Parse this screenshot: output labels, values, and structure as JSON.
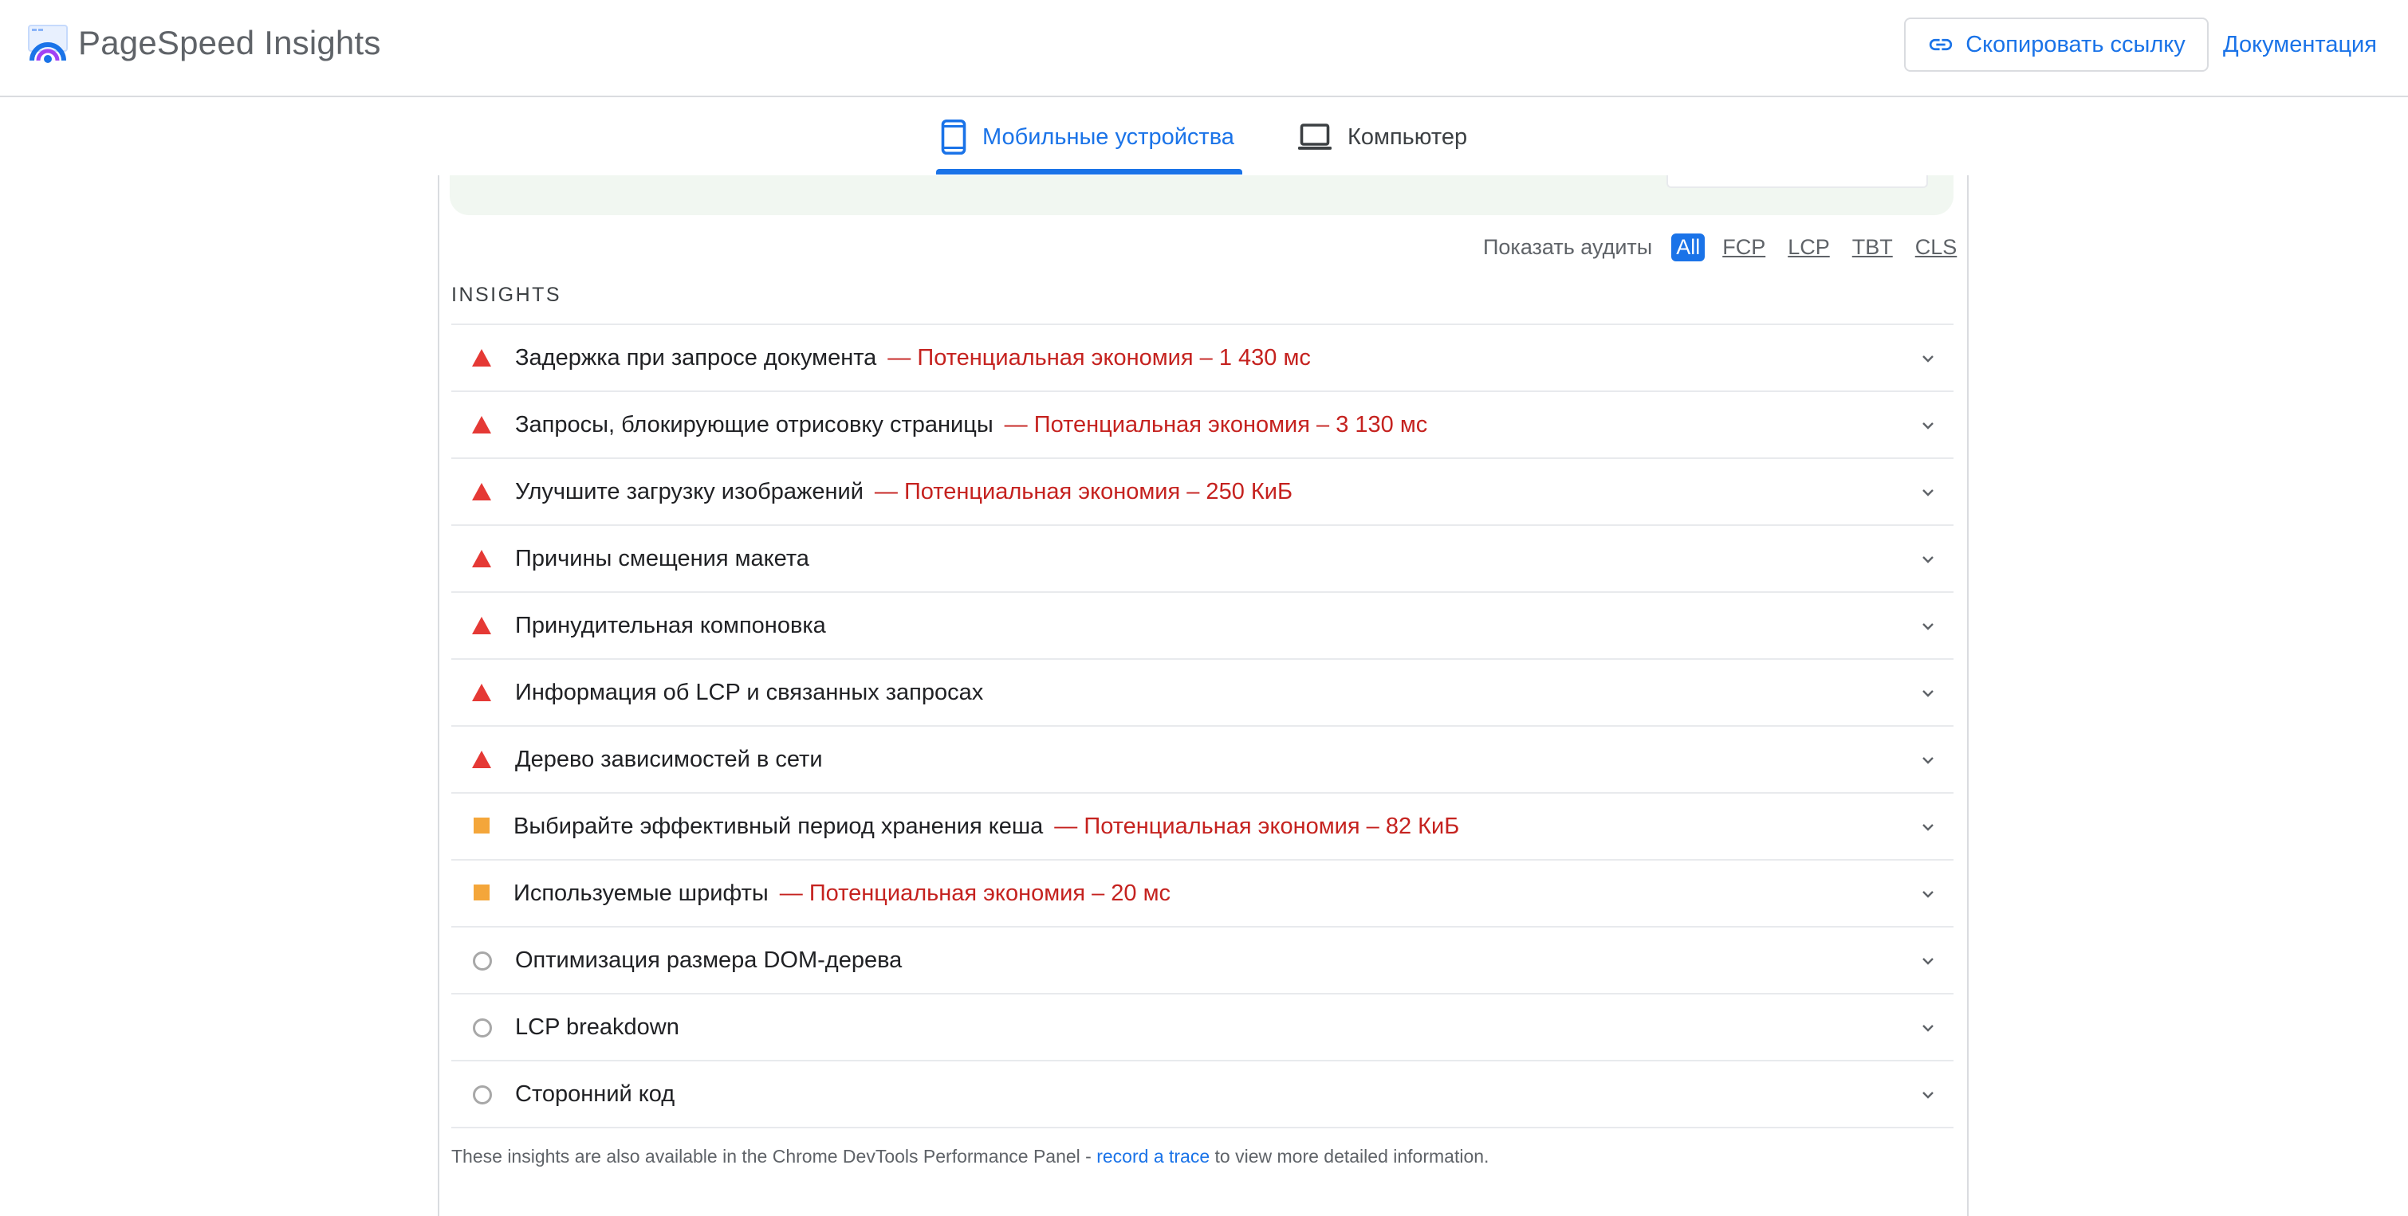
{
  "header": {
    "brand": "PageSpeed Insights",
    "copy_link_label": "Скопировать ссылку",
    "docs_label": "Документация",
    "accent": "#1a73e8"
  },
  "tabs": [
    {
      "label": "Мобильные устройства",
      "icon": "smartphone-icon",
      "active": true
    },
    {
      "label": "Компьютер",
      "icon": "laptop-icon",
      "active": false
    }
  ],
  "filters": {
    "label": "Показать аудиты",
    "chips": [
      "All",
      "FCP",
      "LCP",
      "TBT",
      "CLS"
    ],
    "selected": "All"
  },
  "insights": {
    "title": "INSIGHTS",
    "items": [
      {
        "severity": "fail",
        "title": "Задержка при запросе документа",
        "saving": "— Потенциальная экономия – 1 430 мс"
      },
      {
        "severity": "fail",
        "title": "Запросы, блокирующие отрисовку страницы",
        "saving": "— Потенциальная экономия – 3 130 мс"
      },
      {
        "severity": "fail",
        "title": "Улучшите загрузку изображений",
        "saving": "— Потенциальная экономия – 250 КиБ"
      },
      {
        "severity": "fail",
        "title": "Причины смещения макета",
        "saving": ""
      },
      {
        "severity": "fail",
        "title": "Принудительная компоновка",
        "saving": ""
      },
      {
        "severity": "fail",
        "title": "Информация об LCP и связанных запросах",
        "saving": ""
      },
      {
        "severity": "fail",
        "title": "Дерево зависимостей в сети",
        "saving": ""
      },
      {
        "severity": "average",
        "title": "Выбирайте эффективный период хранения кеша",
        "saving": "— Потенциальная экономия – 82 КиБ"
      },
      {
        "severity": "average",
        "title": "Используемые шрифты",
        "saving": "— Потенциальная экономия – 20 мс"
      },
      {
        "severity": "info",
        "title": "Оптимизация размера DOM-дерева",
        "saving": ""
      },
      {
        "severity": "info",
        "title": "LCP breakdown",
        "saving": ""
      },
      {
        "severity": "info",
        "title": "Сторонний код",
        "saving": ""
      }
    ],
    "colors": {
      "fail": "#e53935",
      "average": "#f4a63a",
      "info": "#a8a8a8",
      "saving": "#c5221f"
    }
  },
  "footnote": {
    "before": "These insights are also available in the Chrome DevTools Performance Panel - ",
    "link": "record a trace",
    "after": " to view more detailed information."
  }
}
